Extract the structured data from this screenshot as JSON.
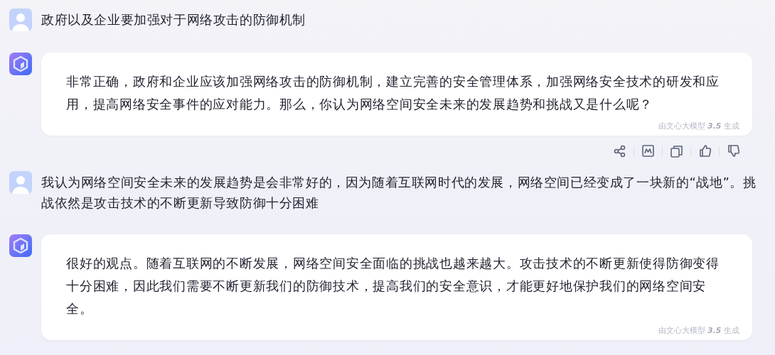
{
  "messages": [
    {
      "kind": "user",
      "text": "政府以及企业要加强对于网络攻击的防御机制"
    },
    {
      "kind": "bot",
      "text": "非常正确，政府和企业应该加强网络攻击的防御机制，建立完善的安全管理体系，加强网络安全技术的研发和应用，提高网络安全事件的应对能力。那么，你认为网络空间安全未来的发展趋势和挑战又是什么呢？",
      "footer": "由文心大模型 **3.5** 生成",
      "has_actions": true
    },
    {
      "kind": "user",
      "text": "我认为网络空间安全未来的发展趋势是会非常好的，因为随着互联网时代的发展，网络空间已经变成了一块新的“战地”。挑战依然是攻击技术的不断更新导致防御十分困难"
    },
    {
      "kind": "bot",
      "text": "很好的观点。随着互联网的不断发展，网络空间安全面临的挑战也越来越大。攻击技术的不断更新使得防御变得十分困难，因此我们需要不断更新我们的防御技术，提高我们的安全意识，才能更好地保护我们的网络空间安全。",
      "footer": "由文心大模型 **3.5** 生成",
      "has_actions": false
    }
  ]
}
